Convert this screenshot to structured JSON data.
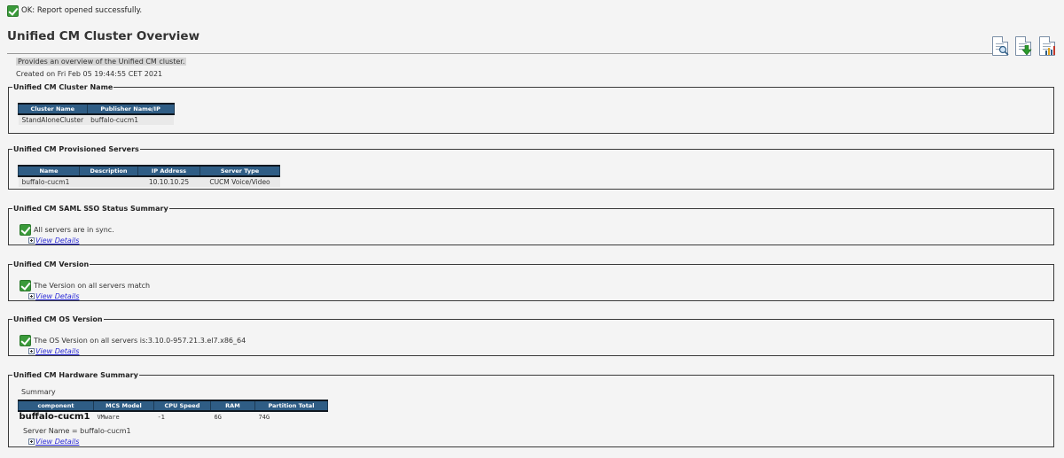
{
  "status": {
    "message": "OK: Report opened successfully."
  },
  "report": {
    "title": "Unified CM Cluster Overview",
    "description": "Provides an overview of the Unified CM cluster.",
    "created": "Created on Fri Feb 05 19:44:55 CET 2021"
  },
  "toolbar": {
    "icons": [
      "view-report-icon",
      "download-report-icon",
      "chart-report-icon"
    ]
  },
  "cluster_name": {
    "legend": "Unified CM Cluster Name",
    "headers": [
      "Cluster Name",
      "Publisher Name/IP"
    ],
    "rows": [
      [
        "StandAloneCluster",
        "buffalo-cucm1"
      ]
    ]
  },
  "servers": {
    "legend": "Unified CM Provisioned Servers",
    "headers": [
      "Name",
      "Description",
      "IP Address",
      "Server Type"
    ],
    "rows": [
      [
        "buffalo-cucm1",
        "",
        "10.10.10.25",
        "CUCM Voice/Video"
      ]
    ]
  },
  "saml": {
    "legend": "Unified CM SAML SSO Status Summary",
    "status": "All servers are in sync.",
    "link": "View Details"
  },
  "version": {
    "legend": "Unified CM Version",
    "status": "The Version on all servers match",
    "link": "View Details"
  },
  "os_version": {
    "legend": "Unified CM OS Version",
    "status": "The OS Version on all servers is:3.10.0-957.21.3.el7.x86_64",
    "link": "View Details"
  },
  "hardware": {
    "legend": "Unified CM Hardware Summary",
    "summary_label": "Summary",
    "headers": [
      "component",
      "MCS Model",
      "CPU Speed",
      "RAM",
      "Partition Total"
    ],
    "host": "buffalo-cucm1",
    "row": [
      "VMware",
      "-1",
      "6G",
      "74G"
    ],
    "server_name": "Server Name = buffalo-cucm1",
    "link": "View Details"
  },
  "colors": {
    "header_bg": "#2f5d85",
    "ok_green": "#3a9a3a",
    "link": "#2b2bd6"
  }
}
